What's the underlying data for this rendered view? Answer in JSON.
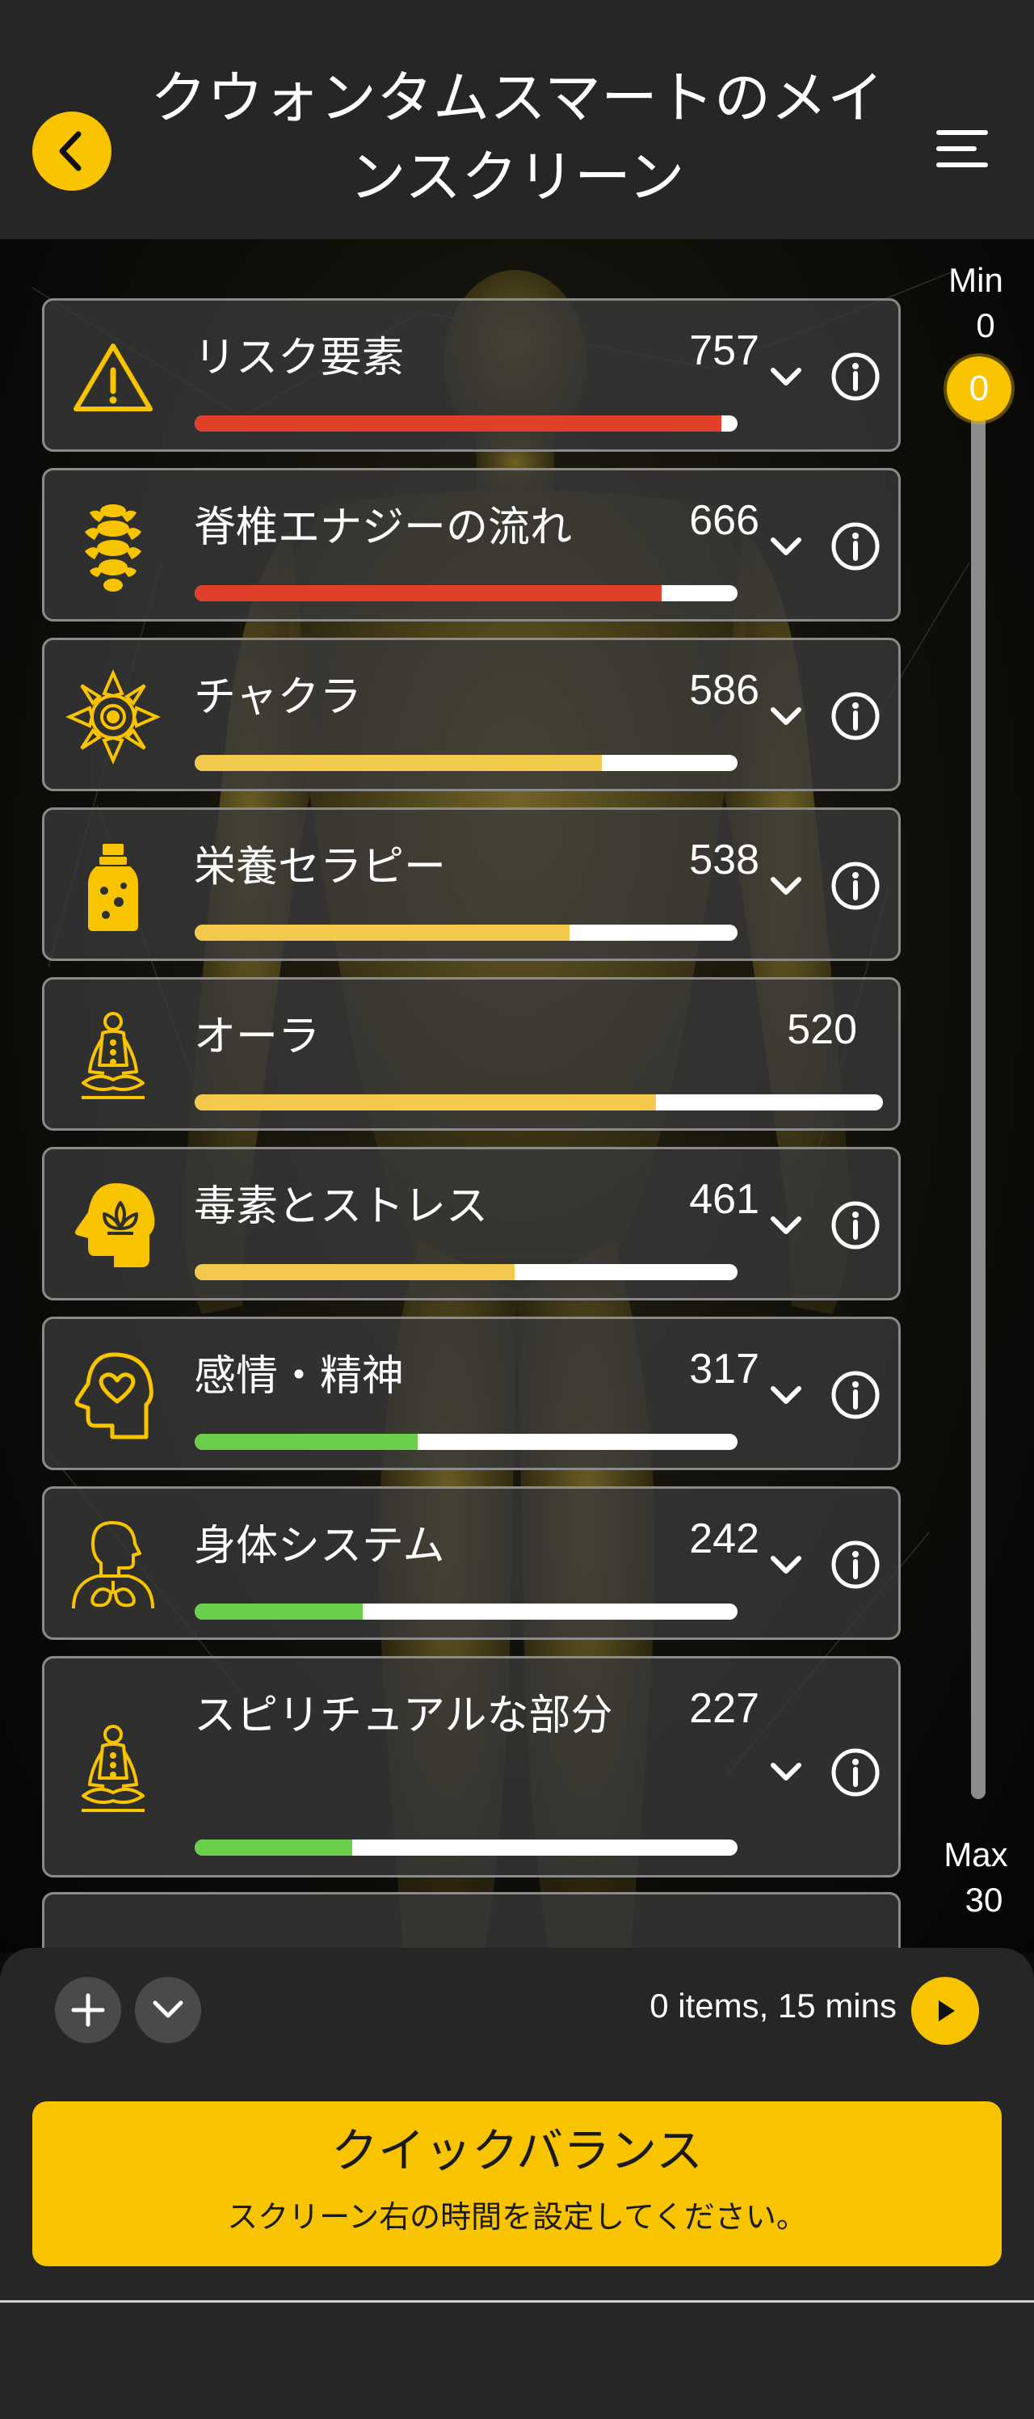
{
  "header": {
    "title": "クウォンタムスマートのメインスクリーン",
    "back_icon": "chevron-left-icon",
    "menu_icon": "hamburger-menu-icon"
  },
  "slider": {
    "min_label": "Min",
    "min_value": "0",
    "max_label": "Max",
    "max_value": "30",
    "current": "0"
  },
  "categories": [
    {
      "label": "リスク要素",
      "value": "757",
      "level": 0.97,
      "color": "#e0402a",
      "icon": "warning-icon"
    },
    {
      "label": "脊椎エナジーの流れ",
      "value": "666",
      "level": 0.86,
      "color": "#e0402a",
      "icon": "spine-icon"
    },
    {
      "label": "チャクラ",
      "value": "586",
      "level": 0.75,
      "color": "#f2c94c",
      "icon": "mandala-icon"
    },
    {
      "label": "栄養セラピー",
      "value": "538",
      "level": 0.69,
      "color": "#f2c94c",
      "icon": "supplement-bottle-icon"
    },
    {
      "label": "オーラ",
      "value": "520",
      "level": 0.67,
      "color": "#f2c94c",
      "icon": "meditation-figure-icon"
    },
    {
      "label": "毒素とストレス",
      "value": "461",
      "level": 0.59,
      "color": "#f2c94c",
      "icon": "head-lotus-icon"
    },
    {
      "label": "感情・精神",
      "value": "317",
      "level": 0.41,
      "color": "#6ad04b",
      "icon": "head-heart-icon"
    },
    {
      "label": "身体システム",
      "value": "242",
      "level": 0.31,
      "color": "#6ad04b",
      "icon": "body-lungs-icon"
    },
    {
      "label": "スピリチュアルな部分",
      "value": "227",
      "level": 0.29,
      "color": "#6ad04b",
      "icon": "meditation-figure-icon"
    }
  ],
  "bottom": {
    "summary": "0 items, 15 mins",
    "quick_title": "クイックバランス",
    "quick_subtitle": "スクリーン右の時間を設定してください。"
  },
  "colors": {
    "accent": "#f8c400",
    "header_bg": "#262626",
    "high": "#e0402a",
    "mid": "#f2c94c",
    "low": "#6ad04b"
  }
}
